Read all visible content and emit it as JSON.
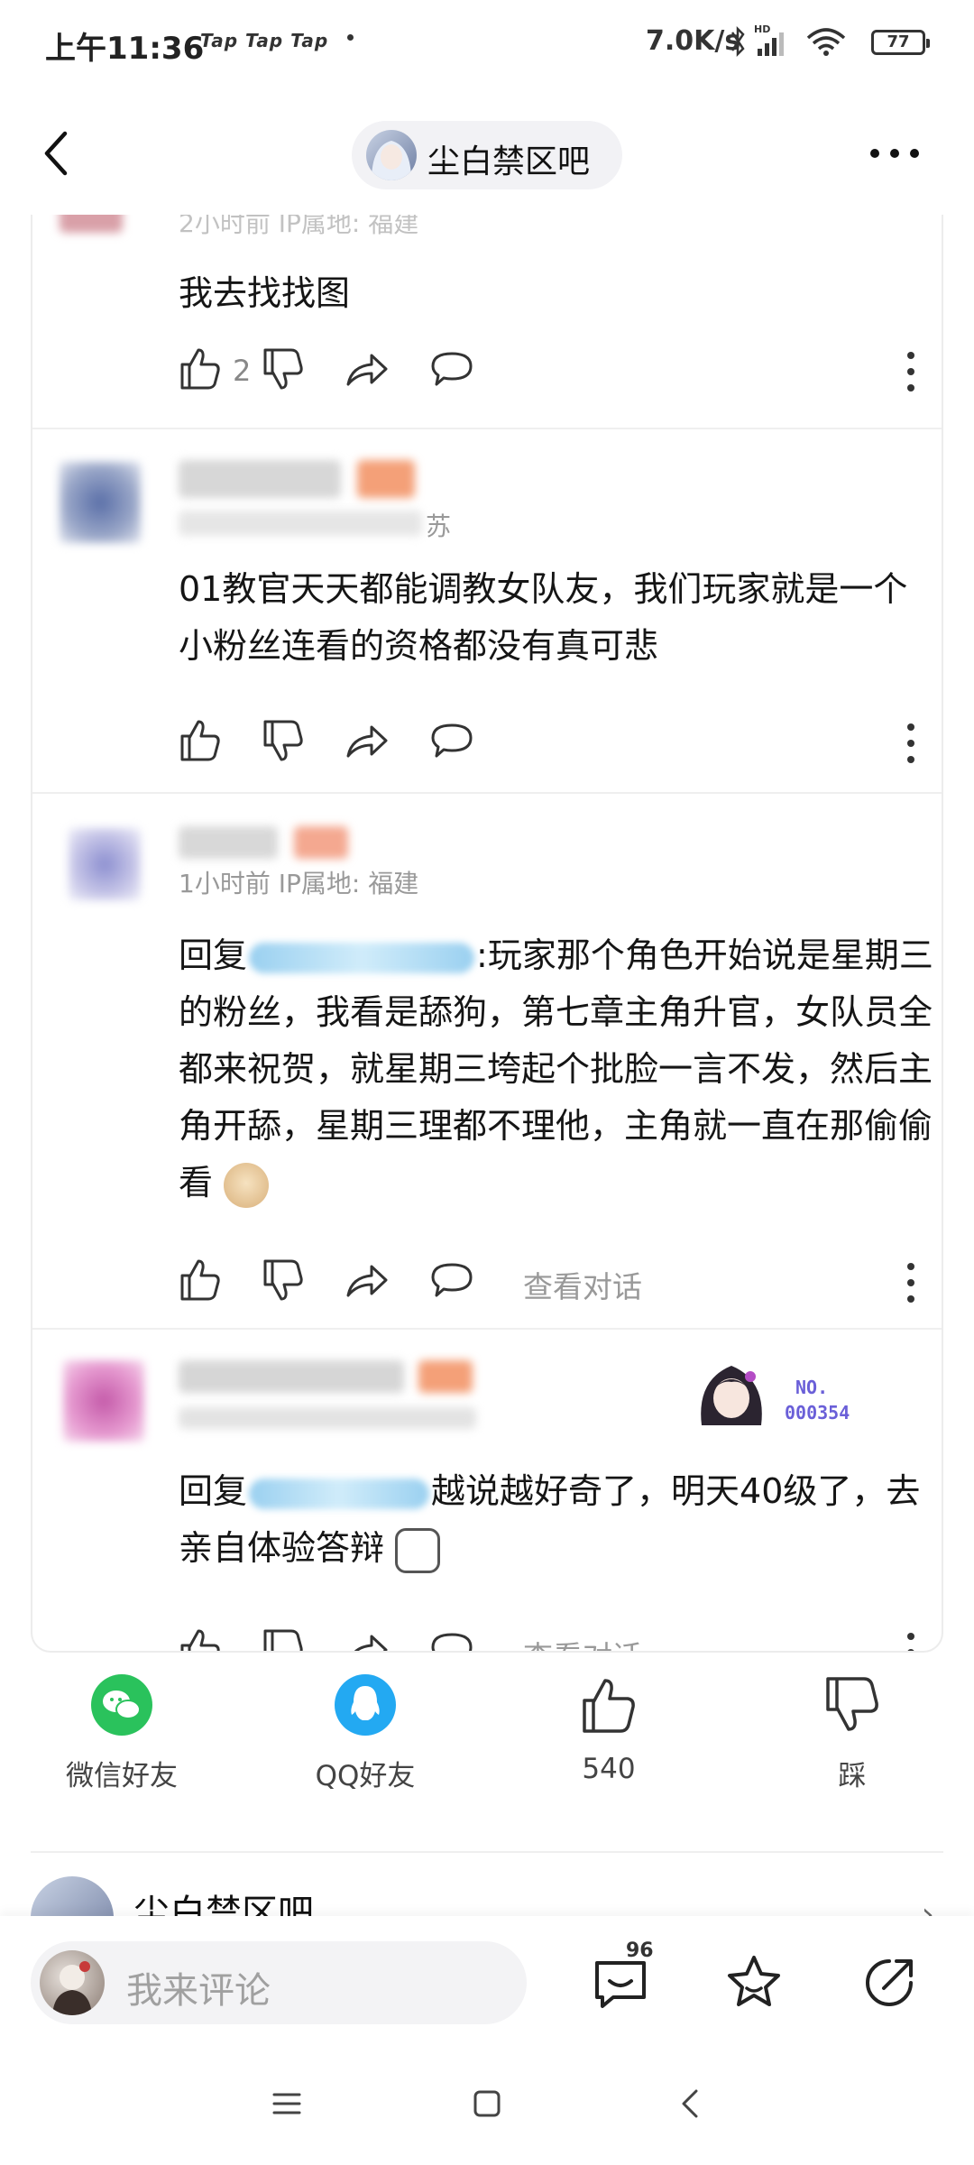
{
  "status": {
    "time": "上午11:36",
    "apps": "Tap  Tap  Tap",
    "speed": "7.0K/s",
    "battery": "77"
  },
  "header": {
    "forum_name": "尘白禁区吧"
  },
  "comments": [
    {
      "meta": "2小时前  IP属地: 福建",
      "text": "我去找找图",
      "likes": "2"
    },
    {
      "meta_tail": "苏",
      "text": "01教官天天都能调教女队友，我们玩家就是一个小粉丝连看的资格都没有真可悲"
    },
    {
      "meta": "1小时前  IP属地: 福建",
      "reply_prefix": "回复",
      "text": ":玩家那个角色开始说是星期三的粉丝，我看是舔狗，第七章主角升官，女队员全都来祝贺，就星期三垮起个批脸一言不发，然后主角开舔，星期三理都不理他，主角就一直在那偷偷看",
      "view_conversation": "查看对话"
    },
    {
      "reply_prefix": "回复",
      "text": "越说越好奇了，明天40级了，去亲自体验答辩",
      "view_conversation": "查看对话",
      "badge_no": "NO.",
      "badge_num": "000354"
    }
  ],
  "share": {
    "wechat": "微信好友",
    "qq": "QQ好友",
    "like_count": "540",
    "dislike": "踩"
  },
  "forum_peek": {
    "name": "尘白禁区吧"
  },
  "bottom": {
    "placeholder": "我来评论",
    "comment_count": "96"
  }
}
